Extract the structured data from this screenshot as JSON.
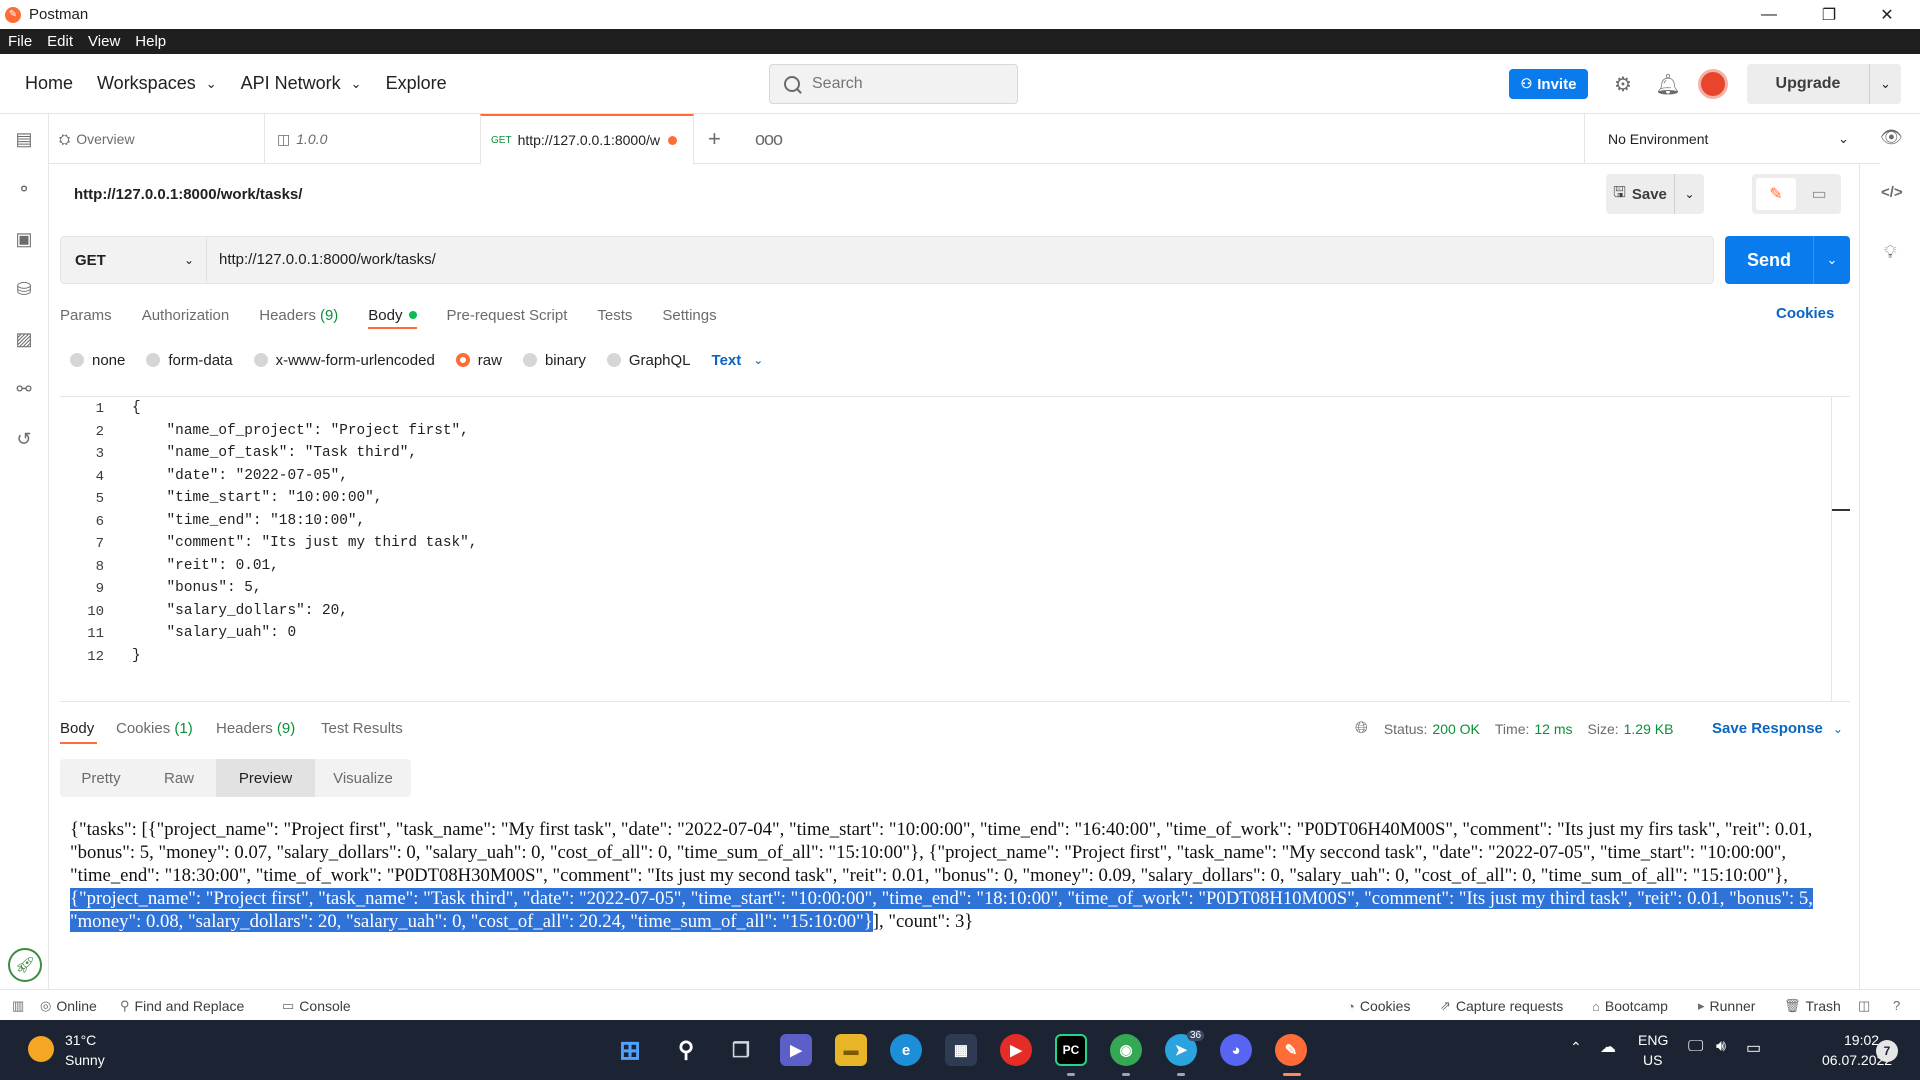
{
  "window": {
    "title": "Postman",
    "minimize": "—",
    "restore": "❐",
    "close": "✕"
  },
  "menu": [
    "File",
    "Edit",
    "View",
    "Help"
  ],
  "header": {
    "nav": [
      {
        "label": "Home"
      },
      {
        "label": "Workspaces",
        "dropdown": true
      },
      {
        "label": "API Network",
        "dropdown": true
      },
      {
        "label": "Explore"
      }
    ],
    "search_placeholder": "Search",
    "invite_label": "Invite",
    "upgrade_label": "Upgrade"
  },
  "tabs": {
    "overview": "Overview",
    "version": "1.0.0",
    "active_method": "GET",
    "active_url": "http://127.0.0.1:8000/w",
    "environment": "No Environment"
  },
  "request": {
    "name": "http://127.0.0.1:8000/work/tasks/",
    "save_label": "Save",
    "method": "GET",
    "url": "http://127.0.0.1:8000/work/tasks/",
    "send_label": "Send",
    "tabs": [
      {
        "label": "Params"
      },
      {
        "label": "Authorization"
      },
      {
        "label": "Headers",
        "count": "(9)"
      },
      {
        "label": "Body",
        "active": true
      },
      {
        "label": "Pre-request Script"
      },
      {
        "label": "Tests"
      },
      {
        "label": "Settings"
      }
    ],
    "cookies_label": "Cookies",
    "body_types": [
      "none",
      "form-data",
      "x-www-form-urlencoded",
      "raw",
      "binary",
      "GraphQL"
    ],
    "body_type_selected": "raw",
    "text_format": "Text",
    "body_lines": [
      "{",
      "    \"name_of_project\": \"Project first\",",
      "    \"name_of_task\": \"Task third\",",
      "    \"date\": \"2022-07-05\",",
      "    \"time_start\": \"10:00:00\",",
      "    \"time_end\": \"18:10:00\",",
      "    \"comment\": \"Its just my third task\",",
      "    \"reit\": 0.01,",
      "    \"bonus\": 5,",
      "    \"salary_dollars\": 20,",
      "    \"salary_uah\": 0",
      "}"
    ]
  },
  "response": {
    "tabs": [
      {
        "label": "Body",
        "active": true
      },
      {
        "label": "Cookies",
        "count": "(1)"
      },
      {
        "label": "Headers",
        "count": "(9)"
      },
      {
        "label": "Test Results"
      }
    ],
    "status_label": "Status:",
    "status_value": "200 OK",
    "time_label": "Time:",
    "time_value": "12 ms",
    "size_label": "Size:",
    "size_value": "1.29 KB",
    "save_response_label": "Save Response",
    "view_modes": [
      "Pretty",
      "Raw",
      "Preview",
      "Visualize"
    ],
    "view_mode_selected": "Preview",
    "preview_before": "{\"tasks\": [{\"project_name\": \"Project first\", \"task_name\": \"My first task\", \"date\": \"2022-07-04\", \"time_start\": \"10:00:00\", \"time_end\": \"16:40:00\", \"time_of_work\": \"P0DT06H40M00S\", \"comment\": \"Its just my firs task\", \"reit\": 0.01, \"bonus\": 5, \"money\": 0.07, \"salary_dollars\": 0, \"salary_uah\": 0, \"cost_of_all\": 0, \"time_sum_of_all\": \"15:10:00\"}, {\"project_name\": \"Project first\", \"task_name\": \"My seccond task\", \"date\": \"2022-07-05\", \"time_start\": \"10:00:00\", \"time_end\": \"18:30:00\", \"time_of_work\": \"P0DT08H30M00S\", \"comment\": \"Its just my second task\", \"reit\": 0.01, \"bonus\": 0, \"money\": 0.09, \"salary_dollars\": 0, \"salary_uah\": 0, \"cost_of_all\": 0, \"time_sum_of_all\": \"15:10:00\"}, ",
    "preview_selected": "{\"project_name\": \"Project first\", \"task_name\": \"Task third\", \"date\": \"2022-07-05\", \"time_start\": \"10:00:00\", \"time_end\": \"18:10:00\", \"time_of_work\": \"P0DT08H10M00S\", \"comment\": \"Its just my third task\", \"reit\": 0.01, \"bonus\": 5, \"money\": 0.08, \"salary_dollars\": 20, \"salary_uah\": 0, \"cost_of_all\": 20.24, \"time_sum_of_all\": \"15:10:00\"}",
    "preview_after": "], \"count\": 3}"
  },
  "statusbar": {
    "online": "Online",
    "find_replace": "Find and Replace",
    "console": "Console",
    "cookies": "Cookies",
    "capture": "Capture requests",
    "bootcamp": "Bootcamp",
    "runner": "Runner",
    "trash": "Trash"
  },
  "taskbar": {
    "weather_temp": "31°C",
    "weather_desc": "Sunny",
    "lang_1": "ENG",
    "lang_2": "US",
    "time": "19:02",
    "date": "06.07.2022",
    "notifications": "7",
    "telegram_badge": "36"
  },
  "colors": {
    "accent": "#ff6c37",
    "primary": "#097bed",
    "success": "#0c8f3b",
    "selection": "#2f73d9"
  }
}
